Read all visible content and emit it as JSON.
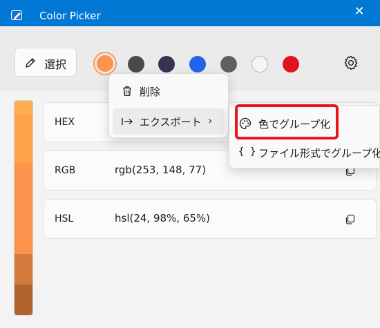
{
  "window": {
    "title": "Color Picker",
    "close_glyph": "✕"
  },
  "toolbar": {
    "select_label": "選択",
    "select_icon": "pen-icon",
    "settings_icon": "gear-icon"
  },
  "swatches": [
    {
      "color": "#fd944d",
      "selected": true
    },
    {
      "color": "#4a4a4a",
      "selected": false
    },
    {
      "color": "#333354",
      "selected": false
    },
    {
      "color": "#2563eb",
      "selected": false
    },
    {
      "color": "#606060",
      "selected": false
    },
    {
      "color": "#f5f5f5",
      "selected": false
    },
    {
      "color": "#e0141e",
      "selected": false
    }
  ],
  "shades": [
    "#feae50",
    "#fea24c",
    "#fd944d",
    "#fd944d",
    "#fd944d",
    "#d57a3f",
    "#b0652f"
  ],
  "fields": [
    {
      "label": "HEX",
      "value": ""
    },
    {
      "label": "RGB",
      "value": "rgb(253, 148, 77)"
    },
    {
      "label": "HSL",
      "value": "hsl(24, 98%, 65%)"
    }
  ],
  "context_menu": {
    "items": [
      {
        "label": "削除",
        "icon": "trash-icon"
      },
      {
        "label": "エクスポート",
        "icon": "export-icon",
        "chevron": "›"
      }
    ]
  },
  "submenu": {
    "items": [
      {
        "label": "色でグループ化",
        "icon": "palette-icon"
      },
      {
        "label": "ファイル形式でグループ化",
        "icon": "braces-icon",
        "icon_text": "{ }"
      }
    ]
  }
}
